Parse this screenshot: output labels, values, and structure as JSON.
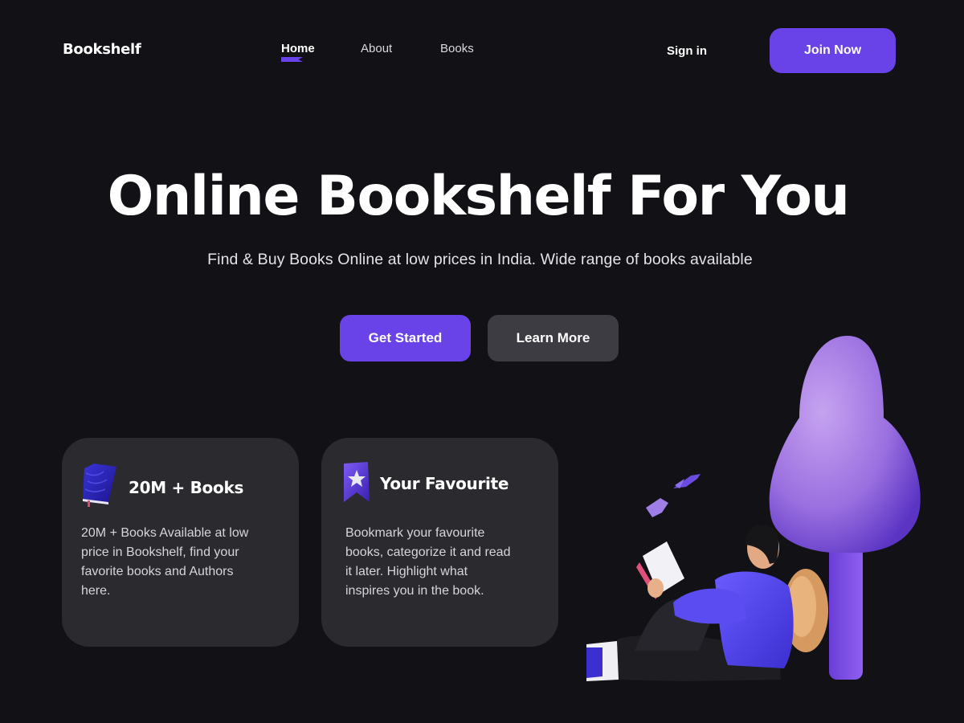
{
  "nav": {
    "logo": "Bookshelf",
    "links": [
      {
        "label": "Home",
        "active": true
      },
      {
        "label": "About",
        "active": false
      },
      {
        "label": "Books",
        "active": false
      }
    ],
    "signin_label": "Sign in",
    "join_label": "Join Now"
  },
  "hero": {
    "title": "Online Bookshelf For You",
    "subtitle": "Find & Buy Books Online at low prices in India. Wide range of books  available",
    "primary_cta": "Get Started",
    "secondary_cta": "Learn More"
  },
  "cards": [
    {
      "icon": "book-icon",
      "title": "20M + Books",
      "lines": [
        "20M + Books Available  at low",
        "price in Bookshelf, find your",
        "favorite books and Authors",
        "here."
      ]
    },
    {
      "icon": "bookmark-star-icon",
      "title": "Your Favourite",
      "lines": [
        "Bookmark your favourite",
        "books, categorize it and read",
        "it later. Highlight what",
        "inspires you in the book."
      ]
    }
  ],
  "colors": {
    "background": "#121216",
    "accent": "#6a43e8",
    "card": "#2a2a2f",
    "secondary_button": "#3c3c42"
  }
}
